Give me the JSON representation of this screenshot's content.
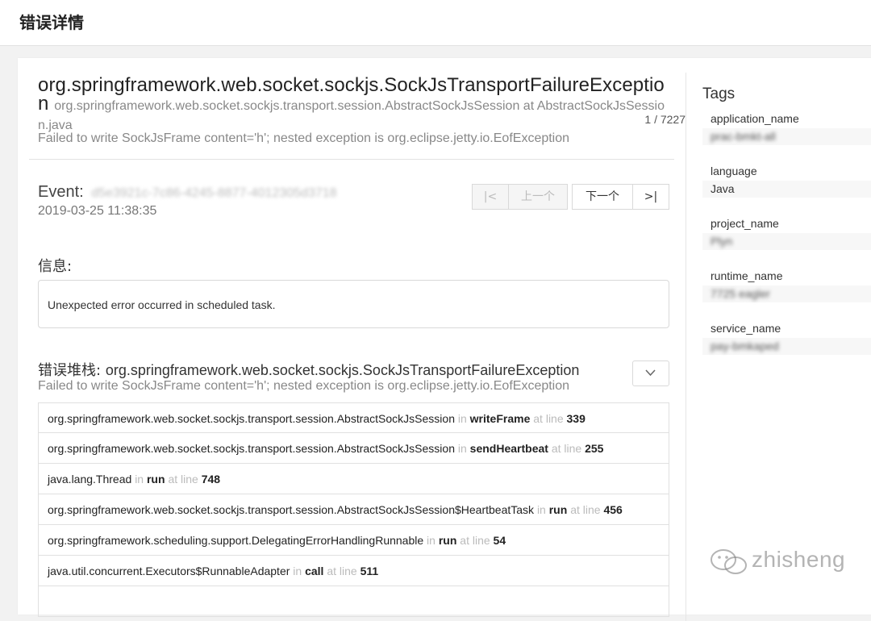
{
  "header": {
    "title": "错误详情"
  },
  "exception": {
    "title": "org.springframework.web.socket.sockjs.SockJsTransportFailureException",
    "location": "org.springframework.web.socket.sockjs.transport.session.AbstractSockJsSession at AbstractSockJsSession.java",
    "counter": "1 / 7227",
    "message": "Failed to write SockJsFrame content='h'; nested exception is org.eclipse.jetty.io.EofException"
  },
  "event": {
    "label": "Event:",
    "id": "d5e3921c-7c86-4245-8877-4012305d3718",
    "time": "2019-03-25 11:38:35"
  },
  "pager": {
    "first_icon": "first-page-icon",
    "first_glyph": "|<",
    "prev": "上一个",
    "next": "下一个",
    "last_icon": "last-page-icon",
    "last_glyph": ">|"
  },
  "info": {
    "label": "信息:",
    "message": "Unexpected error occurred in scheduled task."
  },
  "stack": {
    "label": "错误堆栈:",
    "exception_class": "org.springframework.web.socket.sockjs.SockJsTransportFailureException",
    "message": "Failed to write SockJsFrame content='h'; nested exception is org.eclipse.jetty.io.EofException",
    "toggle_icon": "chevron-down-icon",
    "in_word": "in",
    "at_line_word": "at line",
    "frames": [
      {
        "cls": "org.springframework.web.socket.sockjs.transport.session.AbstractSockJsSession",
        "method": "writeFrame",
        "line": "339"
      },
      {
        "cls": "org.springframework.web.socket.sockjs.transport.session.AbstractSockJsSession",
        "method": "sendHeartbeat",
        "line": "255"
      },
      {
        "cls": "java.lang.Thread",
        "method": "run",
        "line": "748"
      },
      {
        "cls": "org.springframework.web.socket.sockjs.transport.session.AbstractSockJsSession$HeartbeatTask",
        "method": "run",
        "line": "456"
      },
      {
        "cls": "org.springframework.scheduling.support.DelegatingErrorHandlingRunnable",
        "method": "run",
        "line": "54"
      },
      {
        "cls": "java.util.concurrent.Executors$RunnableAdapter",
        "method": "call",
        "line": "511"
      }
    ]
  },
  "tags": {
    "title": "Tags",
    "items": [
      {
        "key": "application_name",
        "value": "prac-bmkt-all",
        "blurred": true
      },
      {
        "key": "language",
        "value": "Java",
        "blurred": false
      },
      {
        "key": "project_name",
        "value": "Plyn",
        "blurred": true
      },
      {
        "key": "runtime_name",
        "value": "7725 eagler",
        "blurred": true
      },
      {
        "key": "service_name",
        "value": "pay-bmkaped",
        "blurred": true
      }
    ]
  },
  "watermark": {
    "text": "zhisheng",
    "icon": "wechat-icon"
  }
}
